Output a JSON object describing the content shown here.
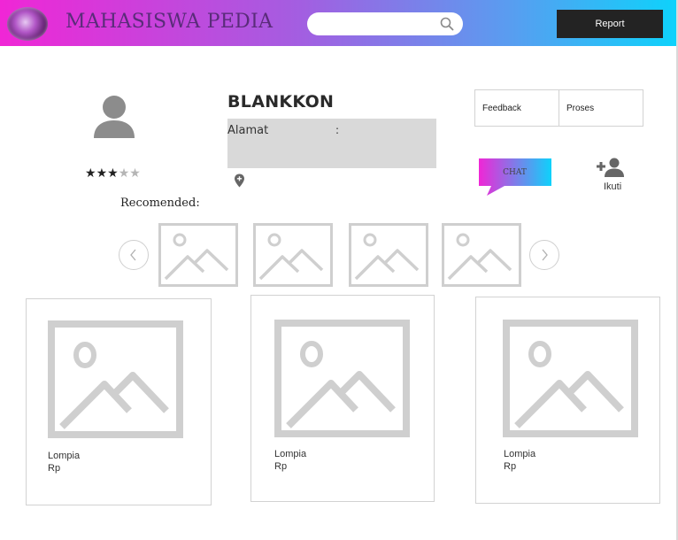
{
  "header": {
    "brand": "MAHASISWA PEDIA",
    "search_placeholder": "",
    "report_label": "Report",
    "colors": {
      "gradient_start": "#f026d6",
      "gradient_end": "#0ed2fb"
    }
  },
  "profile": {
    "name": "BLANKKON",
    "rating": 3,
    "rating_max": 5,
    "address_label": "Alamat",
    "address_colon": ":"
  },
  "actions": {
    "feedback": "Feedback",
    "proses": "Proses",
    "chat": "CHAT",
    "follow": "Ikuti"
  },
  "recommended": {
    "label": "Recomended:"
  },
  "products": [
    {
      "name": "Lompia",
      "price": "Rp"
    },
    {
      "name": "Lompia",
      "price": "Rp"
    },
    {
      "name": "Lompia",
      "price": "Rp"
    }
  ]
}
